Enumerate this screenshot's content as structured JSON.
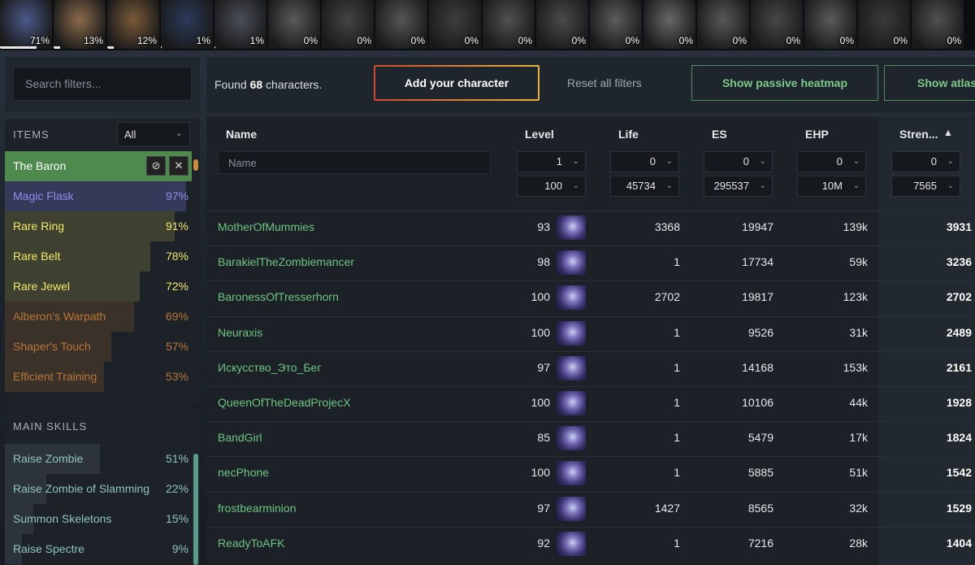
{
  "class_bar": [
    {
      "pct": "71%",
      "fraction": 0.71,
      "color": "#4a5a8a",
      "icon": "sorceress-portrait"
    },
    {
      "pct": "13%",
      "fraction": 0.13,
      "color": "#8a6a4a",
      "icon": "necromancer-portrait"
    },
    {
      "pct": "12%",
      "fraction": 0.12,
      "color": "#7a5a3a",
      "icon": "bearded-portrait"
    },
    {
      "pct": "1%",
      "fraction": 0.01,
      "color": "#2a3a5a",
      "icon": "hooded-portrait"
    },
    {
      "pct": "1%",
      "fraction": 0.01,
      "color": "#4a4f58",
      "icon": "helmet-portrait"
    },
    {
      "pct": "0%",
      "fraction": 0,
      "color": "#5a5a5a",
      "icon": "grey-portrait"
    },
    {
      "pct": "0%",
      "fraction": 0,
      "color": "#444",
      "icon": "grey-portrait"
    },
    {
      "pct": "0%",
      "fraction": 0,
      "color": "#555",
      "icon": "grey-portrait"
    },
    {
      "pct": "0%",
      "fraction": 0,
      "color": "#3e3e3e",
      "icon": "grey-portrait"
    },
    {
      "pct": "0%",
      "fraction": 0,
      "color": "#505050",
      "icon": "grey-portrait"
    },
    {
      "pct": "0%",
      "fraction": 0,
      "color": "#4a4a4a",
      "icon": "grey-portrait"
    },
    {
      "pct": "0%",
      "fraction": 0,
      "color": "#5c5c5c",
      "icon": "grey-portrait"
    },
    {
      "pct": "0%",
      "fraction": 0,
      "color": "#666",
      "icon": "grey-portrait"
    },
    {
      "pct": "0%",
      "fraction": 0,
      "color": "#585858",
      "icon": "grey-portrait"
    },
    {
      "pct": "0%",
      "fraction": 0,
      "color": "#474747",
      "icon": "grey-portrait"
    },
    {
      "pct": "0%",
      "fraction": 0,
      "color": "#5a5a5a",
      "icon": "grey-portrait"
    },
    {
      "pct": "0%",
      "fraction": 0,
      "color": "#3a3a3a",
      "icon": "grey-portrait"
    },
    {
      "pct": "0%",
      "fraction": 0,
      "color": "#505050",
      "icon": "grey-portrait"
    }
  ],
  "search": {
    "placeholder": "Search filters..."
  },
  "items": {
    "header": "ITEMS",
    "select_value": "All",
    "rows": [
      {
        "name": "The Baron",
        "pct": "",
        "fraction": 1,
        "text_color": "#ffffff",
        "fill_color": "#4e8a4e",
        "selected": true
      },
      {
        "name": "Magic Flask",
        "pct": "97%",
        "fraction": 0.97,
        "text_color": "#8f8cf0",
        "fill_color": "#343a58"
      },
      {
        "name": "Rare Ring",
        "pct": "91%",
        "fraction": 0.91,
        "text_color": "#f0ea6a",
        "fill_color": "#3e4030"
      },
      {
        "name": "Rare Belt",
        "pct": "78%",
        "fraction": 0.78,
        "text_color": "#f0ea6a",
        "fill_color": "#3e4030"
      },
      {
        "name": "Rare Jewel",
        "pct": "72%",
        "fraction": 0.72,
        "text_color": "#f0ea6a",
        "fill_color": "#3e4030"
      },
      {
        "name": "Alberon's Warpath",
        "pct": "69%",
        "fraction": 0.69,
        "text_color": "#b8763a",
        "fill_color": "#3a3129"
      },
      {
        "name": "Shaper's Touch",
        "pct": "57%",
        "fraction": 0.57,
        "text_color": "#b8763a",
        "fill_color": "#3a3129"
      },
      {
        "name": "Efficient Training",
        "pct": "53%",
        "fraction": 0.53,
        "text_color": "#b8763a",
        "fill_color": "#3a3129"
      }
    ]
  },
  "skills": {
    "header": "MAIN SKILLS",
    "rows": [
      {
        "name": "Raise Zombie",
        "pct": "51%",
        "fraction": 0.51
      },
      {
        "name": "Raise Zombie of Slamming",
        "pct": "22%",
        "fraction": 0.22
      },
      {
        "name": "Summon Skeletons",
        "pct": "15%",
        "fraction": 0.15
      },
      {
        "name": "Raise Spectre",
        "pct": "9%",
        "fraction": 0.09
      }
    ]
  },
  "toolbar": {
    "found_prefix": "Found ",
    "found_count": "68",
    "found_suffix": " characters.",
    "add_label": "Add your character",
    "reset_label": "Reset all filters",
    "heatmap_label": "Show passive heatmap",
    "atlas_label": "Show atlas"
  },
  "table": {
    "headers": {
      "name": "Name",
      "level": "Level",
      "life": "Life",
      "es": "ES",
      "ehp": "EHP",
      "strength": "Stren...",
      "sort_icon": "sort-desc-icon"
    },
    "name_placeholder": "Name",
    "filters": {
      "level": {
        "min": "1",
        "max": "100"
      },
      "life": {
        "min": "0",
        "max": "45734"
      },
      "es": {
        "min": "0",
        "max": "295537"
      },
      "ehp": {
        "min": "0",
        "max": "10M"
      },
      "strength": {
        "min": "0",
        "max": "7565"
      }
    },
    "rows": [
      {
        "name": "MotherOfMummies",
        "level": "93",
        "life": "3368",
        "es": "19947",
        "ehp": "139k",
        "str": "3931"
      },
      {
        "name": "BarakielTheZombiemancer",
        "level": "98",
        "life": "1",
        "es": "17734",
        "ehp": "59k",
        "str": "3236"
      },
      {
        "name": "BaronessOfTresserhorn",
        "level": "100",
        "life": "2702",
        "es": "19817",
        "ehp": "123k",
        "str": "2702"
      },
      {
        "name": "Neuraxis",
        "level": "100",
        "life": "1",
        "es": "9526",
        "ehp": "31k",
        "str": "2489"
      },
      {
        "name": "Искусство_Это_Бег",
        "level": "97",
        "life": "1",
        "es": "14168",
        "ehp": "153k",
        "str": "2161"
      },
      {
        "name": "QueenOfTheDeadProjecX",
        "level": "100",
        "life": "1",
        "es": "10106",
        "ehp": "44k",
        "str": "1928"
      },
      {
        "name": "BandGirl",
        "level": "85",
        "life": "1",
        "es": "5479",
        "ehp": "17k",
        "str": "1824"
      },
      {
        "name": "necPhone",
        "level": "100",
        "life": "1",
        "es": "5885",
        "ehp": "51k",
        "str": "1542"
      },
      {
        "name": "frostbearminion",
        "level": "97",
        "life": "1427",
        "es": "8565",
        "ehp": "32k",
        "str": "1529"
      },
      {
        "name": "ReadyToAFK",
        "level": "92",
        "life": "1",
        "es": "7216",
        "ehp": "28k",
        "str": "1404"
      }
    ]
  }
}
